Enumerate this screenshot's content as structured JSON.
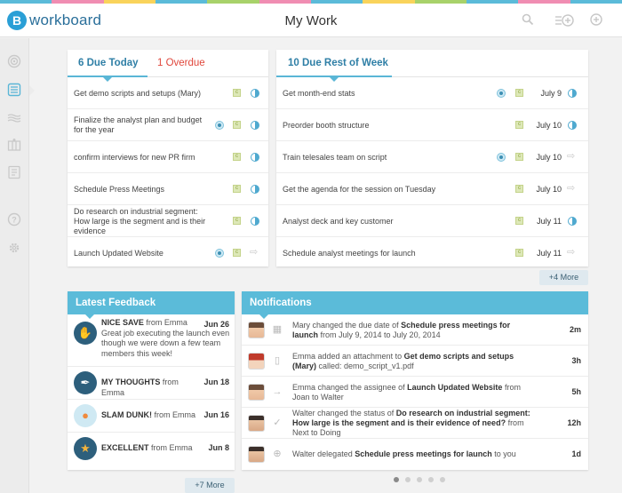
{
  "app": {
    "logo_mark": "B",
    "logo_text": "workboard",
    "title": "My Work"
  },
  "header_icons": [
    "search-icon",
    "add-list-icon",
    "add-icon"
  ],
  "sidebar_icons": [
    "target-icon",
    "my-work-icon",
    "activity-icon",
    "team-icon",
    "reports-icon",
    "help-icon",
    "settings-icon"
  ],
  "colors": {
    "accent": "#5bbbd9",
    "overdue": "#e0473c",
    "brand": "#2a6f9a"
  },
  "due_today": {
    "tab_due": "6 Due Today",
    "tab_overdue": "1 Overdue",
    "items": [
      {
        "text": "Get demo scripts and setups (Mary)",
        "target": false,
        "end": "half"
      },
      {
        "text": "Finalize the analyst plan and budget for the year",
        "target": true,
        "end": "half"
      },
      {
        "text": "confirm interviews for new PR firm",
        "target": false,
        "end": "half"
      },
      {
        "text": "Schedule Press Meetings",
        "target": false,
        "end": "half"
      },
      {
        "text": "Do research on industrial segment: How large is the segment and is their evidence",
        "target": false,
        "end": "half"
      },
      {
        "text": "Launch Updated Website",
        "target": true,
        "end": "arrow"
      }
    ]
  },
  "rest_of_week": {
    "tab": "10 Due Rest of Week",
    "items": [
      {
        "text": "Get month-end stats",
        "target": true,
        "date": "July 9",
        "end": "half"
      },
      {
        "text": "Preorder booth structure",
        "target": false,
        "date": "July 10",
        "end": "half"
      },
      {
        "text": "Train telesales team on script",
        "target": true,
        "date": "July 10",
        "end": "arrow"
      },
      {
        "text": "Get the agenda for the session on Tuesday",
        "target": false,
        "date": "July 10",
        "end": "arrow"
      },
      {
        "text": "Analyst deck and key customer",
        "target": false,
        "date": "July 11",
        "end": "half"
      },
      {
        "text": "Schedule analyst meetings for launch",
        "target": false,
        "date": "July 11",
        "end": "arrow"
      }
    ],
    "more": "+4 More"
  },
  "feedback": {
    "title": "Latest Feedback",
    "items": [
      {
        "title": "NICE SAVE",
        "from": " from Emma",
        "message": "Great job executing the launch even though we were down a few team members this week!",
        "date": "Jun 26",
        "icon": "save-icon",
        "color": "#2d5f7c"
      },
      {
        "title": "MY THOUGHTS",
        "from": " from Emma",
        "message": "",
        "date": "Jun 18",
        "icon": "pen-icon",
        "color": "#2d5f7c"
      },
      {
        "title": "SLAM DUNK!",
        "from": " from Emma",
        "message": "",
        "date": "Jun 16",
        "icon": "basketball-icon",
        "color": "#5bbbd9"
      },
      {
        "title": "EXCELLENT",
        "from": " from Emma",
        "message": "",
        "date": "Jun 8",
        "icon": "trophy-icon",
        "color": "#2d5f7c"
      }
    ],
    "more": "+7 More"
  },
  "notifications": {
    "title": "Notifications",
    "items": [
      {
        "pre": "Mary changed the due date of ",
        "bold": "Schedule press meetings for launch",
        "post": " from July 9, 2014 to July 20, 2014",
        "time": "2m",
        "icon": "calendar-icon"
      },
      {
        "pre": "Emma added an attachment to ",
        "bold": "Get demo scripts and setups (Mary)",
        "post": " called: demo_script_v1.pdf",
        "time": "3h",
        "icon": "document-icon"
      },
      {
        "pre": "Emma changed the assignee of ",
        "bold": "Launch Updated Website",
        "post": " from Joan to Walter",
        "time": "5h",
        "icon": "assign-icon"
      },
      {
        "pre": "Walter changed the status of ",
        "bold": "Do research on industrial segment: How large is the segment and is their evidence of need?",
        "post": " from Next to Doing",
        "time": "12h",
        "icon": "check-icon"
      },
      {
        "pre": "Walter delegated ",
        "bold": "Schedule press meetings for launch",
        "post": " to you",
        "time": "1d",
        "icon": "delegate-icon"
      }
    ]
  },
  "pager": {
    "count": 5,
    "active": 0
  }
}
